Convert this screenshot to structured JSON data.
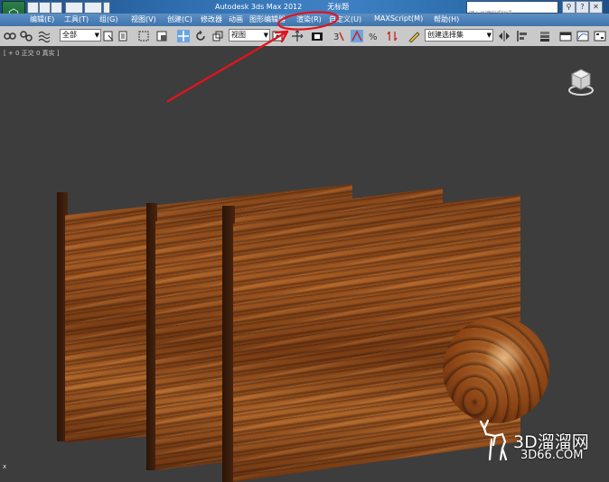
{
  "window": {
    "title": "Autodesk 3ds Max  2012",
    "title_suffix": "无标题",
    "search_placeholder": "键入关键字或短语"
  },
  "menu": {
    "items": [
      "编辑(E)",
      "工具(T)",
      "组(G)",
      "视图(V)",
      "创建(C)",
      "修改器",
      "动画",
      "图形编辑器",
      "渲染(R)",
      "自定义(U)",
      "MAXScript(M)",
      "帮助(H)"
    ],
    "highlighted": "渲染(R)"
  },
  "toolbar": {
    "selection_filter": "全部",
    "ref_coord": "视图",
    "named_selection": "创建选择集"
  },
  "viewport": {
    "label": "[ + 0 正交 0 真实 ]",
    "axis_label": "x"
  },
  "watermark": {
    "line1": "3D溜溜网",
    "line2": "3D66.COM"
  },
  "colors": {
    "annotation": "#e0141e",
    "viewport_bg": "#3d3d3d",
    "titlebar": "#3f82c4"
  }
}
